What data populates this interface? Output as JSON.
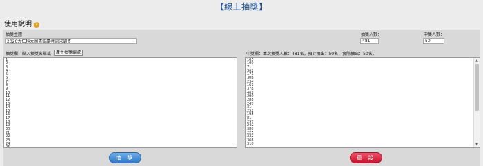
{
  "header": {
    "title": "【線上抽獎】"
  },
  "section": {
    "title": "使用說明",
    "help_icon": "question-circle-icon",
    "help_glyph": "?"
  },
  "form": {
    "topic_label": "抽獎主題：",
    "topic_value": "2020大仁科大圖書館讀者需求調查",
    "count_label": "抽獎人數：",
    "count_value": "481",
    "winners_label": "中獎人數：",
    "winners_value": "50",
    "pool_label": "抽獎欄：貼入抽獎名單或",
    "generate_button": "產生抽獎編號",
    "result_label": "中獎欄：本次抽獎人數：481名，預計抽出：50名，實際抽出：50名。"
  },
  "pool_lines": [
    "1",
    "2",
    "3",
    "4",
    "5",
    "6",
    "7",
    "8",
    "9",
    "10",
    "11",
    "12",
    "13",
    "14",
    "15",
    "16",
    "17",
    "18",
    "19",
    "20",
    "21",
    "22",
    "23",
    "24",
    "25"
  ],
  "result_lines": [
    "105",
    "100",
    "71",
    "362",
    "171",
    "306",
    "234",
    "161",
    "378",
    "462",
    "200",
    "288",
    "247",
    "31",
    "252",
    "195",
    "81",
    "297",
    "242",
    "389",
    "225",
    "332",
    "366",
    "310"
  ],
  "buttons": {
    "draw": "抽 獎",
    "reset": "重 設"
  },
  "colors": {
    "title": "#1a4f9c",
    "draw_button": "#3a86d4",
    "reset_button": "#d9213a",
    "help_icon": "#e6a21a"
  }
}
